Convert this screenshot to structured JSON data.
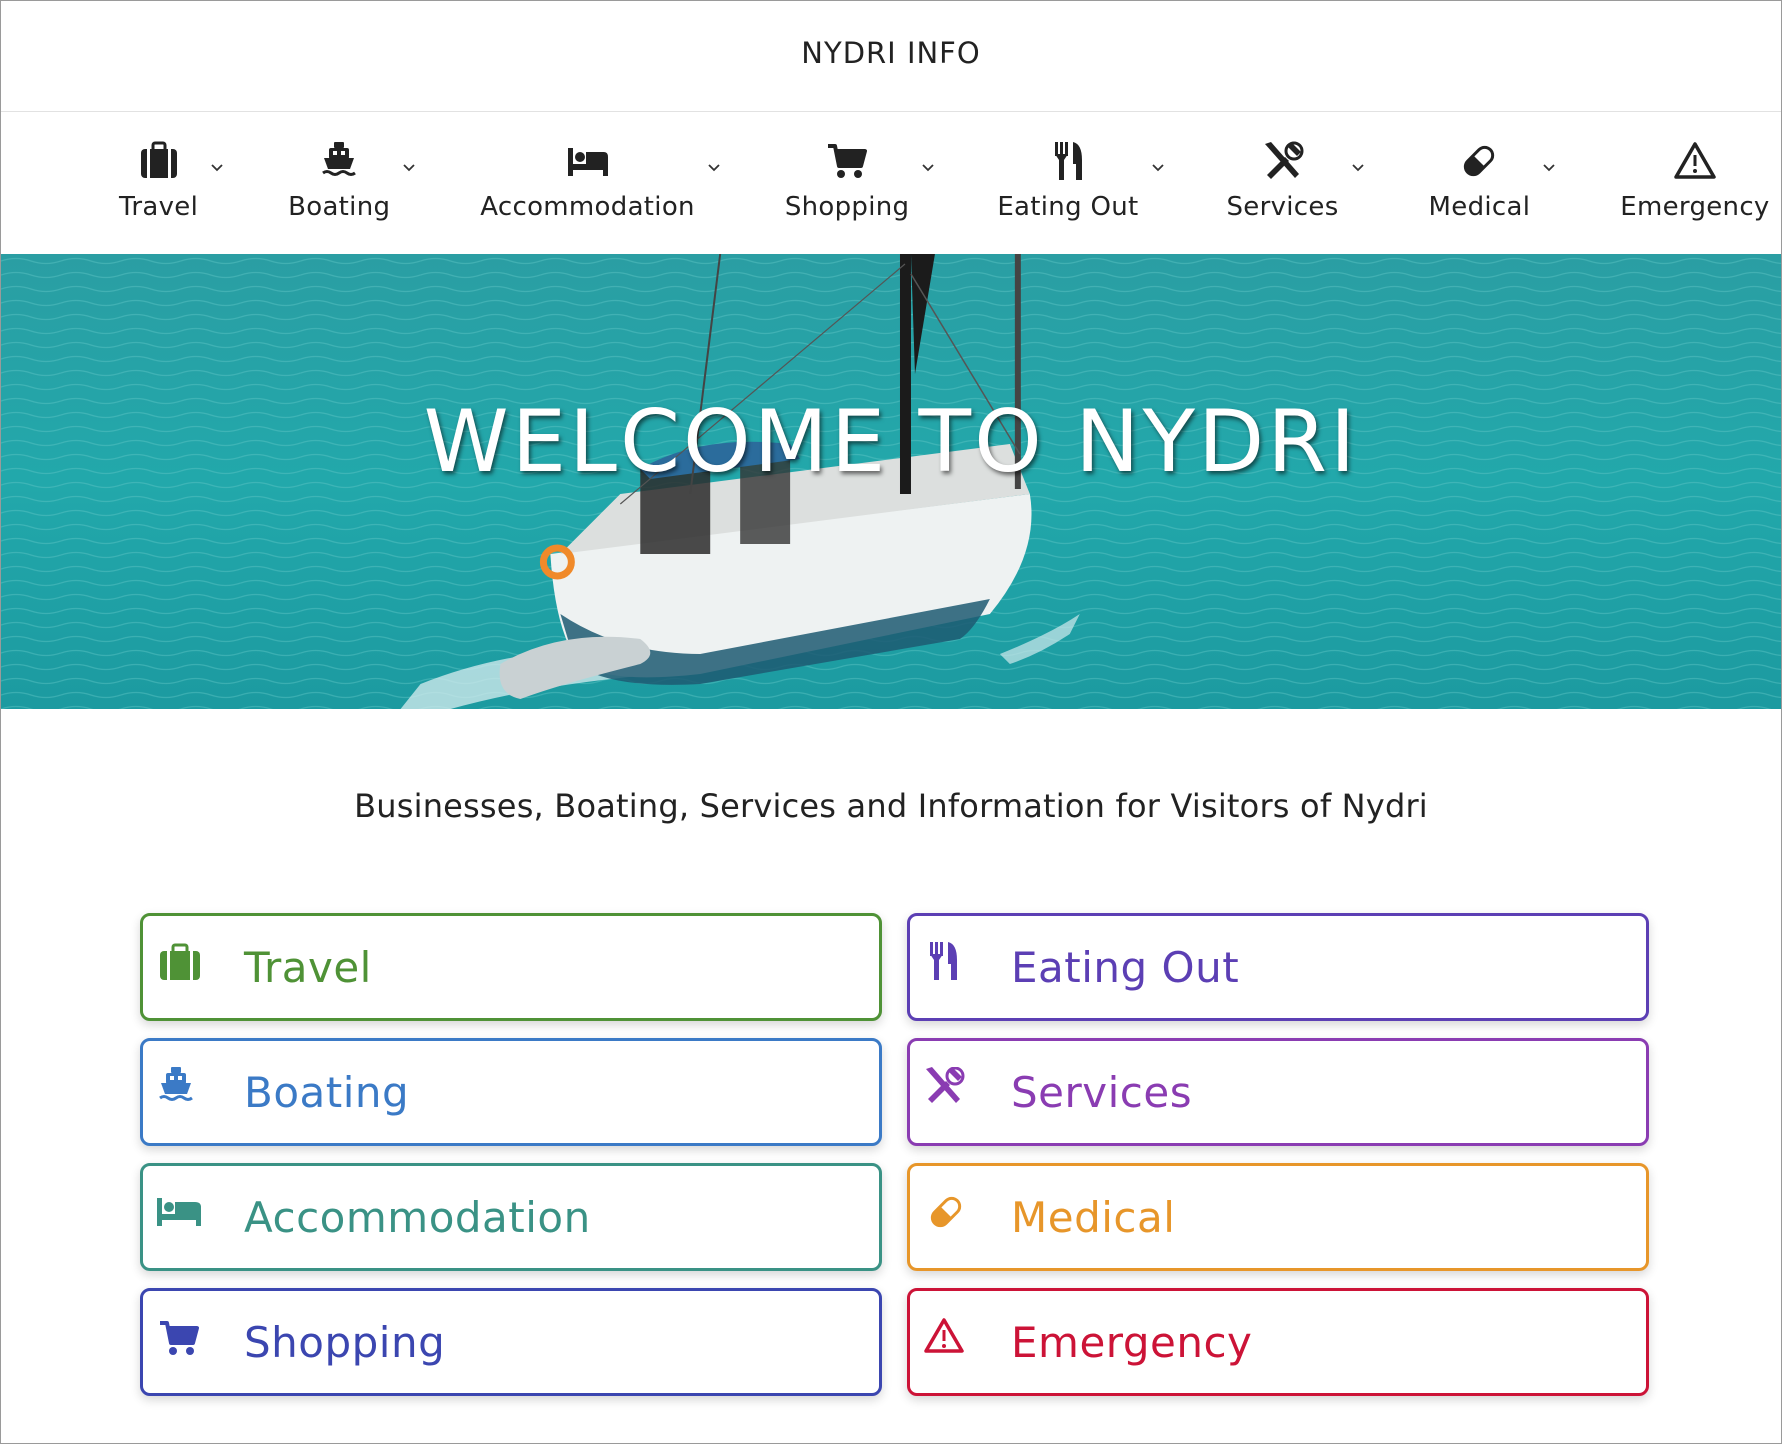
{
  "site": {
    "title": "NYDRI INFO"
  },
  "nav": {
    "items": [
      {
        "label": "Travel",
        "icon": "suitcase-icon"
      },
      {
        "label": "Boating",
        "icon": "ship-icon"
      },
      {
        "label": "Accommodation",
        "icon": "bed-icon"
      },
      {
        "label": "Shopping",
        "icon": "cart-icon"
      },
      {
        "label": "Eating Out",
        "icon": "utensils-icon"
      },
      {
        "label": "Services",
        "icon": "tools-icon"
      },
      {
        "label": "Medical",
        "icon": "pill-icon"
      },
      {
        "label": "Emergency",
        "icon": "warning-icon"
      }
    ]
  },
  "hero": {
    "title": "WELCOME TO NYDRI"
  },
  "tagline": "Businesses, Boating, Services and Information for Visitors of Nydri",
  "categories": [
    {
      "label": "Travel",
      "icon": "suitcase-icon",
      "color": "#4f9236"
    },
    {
      "label": "Eating Out",
      "icon": "utensils-icon",
      "color": "#5c3fb4"
    },
    {
      "label": "Boating",
      "icon": "ship-icon",
      "color": "#3b7ac6"
    },
    {
      "label": "Services",
      "icon": "tools-icon",
      "color": "#8a3cb2"
    },
    {
      "label": "Accommodation",
      "icon": "bed-icon",
      "color": "#3a9285"
    },
    {
      "label": "Medical",
      "icon": "pill-icon",
      "color": "#e7962a"
    },
    {
      "label": "Shopping",
      "icon": "cart-icon",
      "color": "#3b46b0"
    },
    {
      "label": "Emergency",
      "icon": "warning-icon",
      "color": "#cc1337"
    }
  ]
}
